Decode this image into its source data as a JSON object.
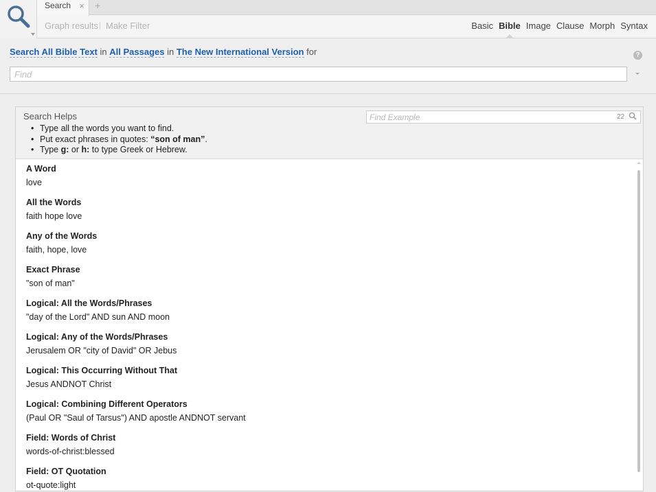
{
  "tab": {
    "label": "Search",
    "close_glyph": "×",
    "add_glyph": "+"
  },
  "toolbar": {
    "graph_results": "Graph results",
    "make_filter": "Make Filter",
    "separator": "|",
    "modes": [
      "Basic",
      "Bible",
      "Image",
      "Clause",
      "Morph",
      "Syntax"
    ],
    "active_mode": "Bible"
  },
  "query": {
    "scope_link": "Search All Bible Text",
    "in1": "in",
    "passages_link": "All Passages",
    "in2": "in",
    "version_link": "The New International Version",
    "for": "for",
    "find_placeholder": "Find",
    "help_glyph": "?"
  },
  "helps": {
    "title": "Search Helps",
    "find_example_placeholder": "Find Example",
    "example_count": "22",
    "tips": [
      {
        "pre": "Type all the words you want to find.",
        "bold": "",
        "post": ""
      },
      {
        "pre": "Put exact phrases in quotes: ",
        "bold": "“son of man”",
        "post": "."
      },
      {
        "pre": "Type ",
        "bold": "g:",
        "mid": " or ",
        "bold2": "h:",
        "post": " to type Greek or Hebrew."
      }
    ],
    "examples": [
      {
        "title": "A Word",
        "query": "love"
      },
      {
        "title": "All the Words",
        "query": "faith hope love"
      },
      {
        "title": "Any of the Words",
        "query": "faith, hope, love"
      },
      {
        "title": "Exact Phrase",
        "query": "\"son of man\""
      },
      {
        "title": "Logical: All the Words/Phrases",
        "query": "\"day of the Lord\" AND sun AND moon"
      },
      {
        "title": "Logical: Any of the Words/Phrases",
        "query": "Jerusalem OR \"city of David\" OR Jebus"
      },
      {
        "title": "Logical: This Occurring Without That",
        "query": "Jesus ANDNOT Christ"
      },
      {
        "title": "Logical: Combining Different Operators",
        "query": "(Paul OR \"Saul of Tarsus\") AND apostle ANDNOT servant"
      },
      {
        "title": "Field: Words of Christ",
        "query": "words-of-christ:blessed"
      },
      {
        "title": "Field: OT Quotation",
        "query": "ot-quote:light"
      }
    ]
  },
  "icons": {
    "logo": "magnifier-icon",
    "search_field": "magnifier-small-icon"
  },
  "colors": {
    "link": "#1f5fa8",
    "accent_bg": "#efefef"
  }
}
